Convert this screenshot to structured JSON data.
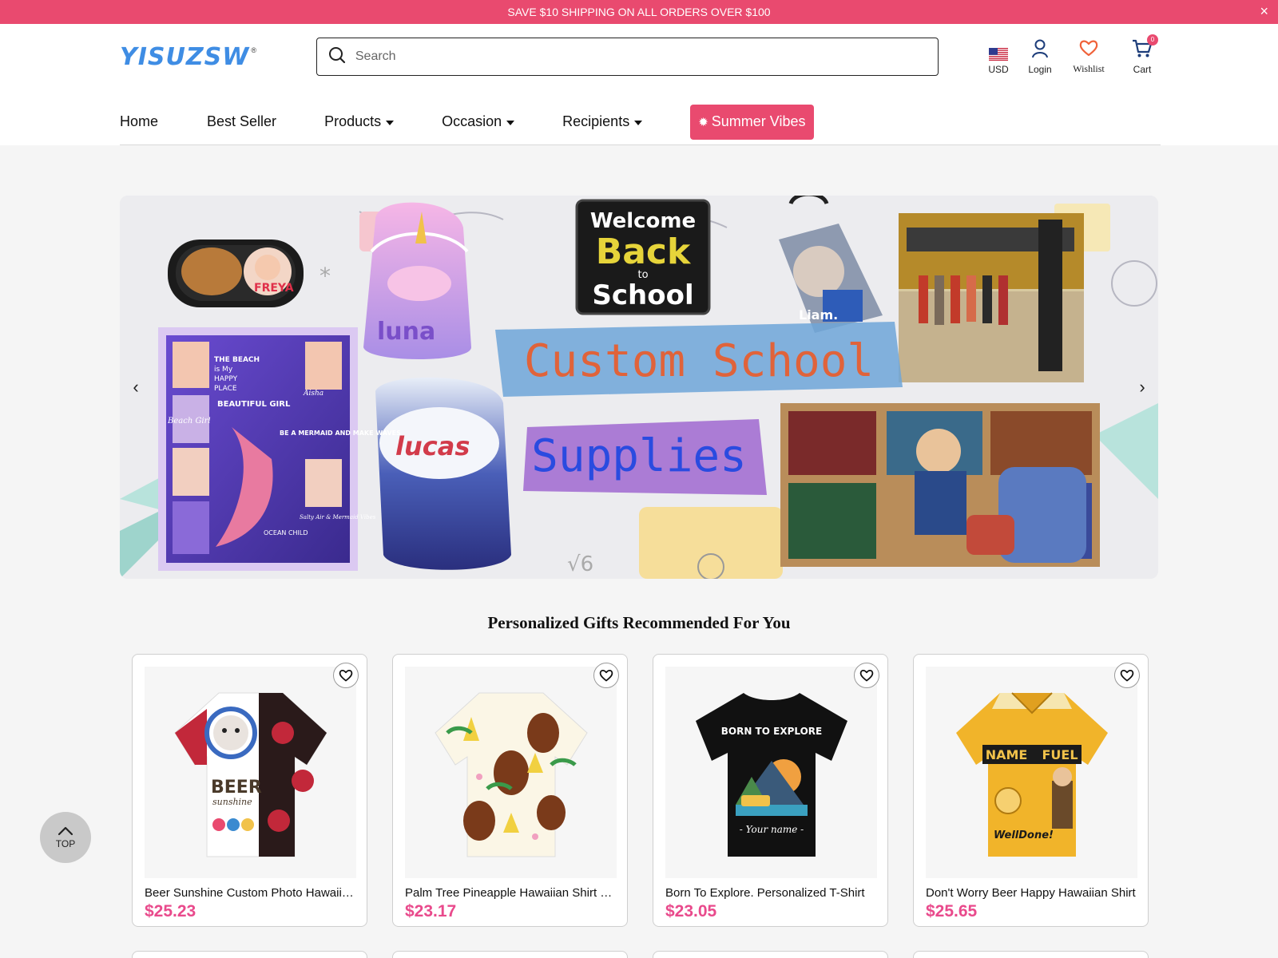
{
  "announcement": {
    "text": "SAVE $10 SHIPPING ON ALL ORDERS OVER $100",
    "close": "×"
  },
  "header": {
    "logo": "YISUZSW",
    "logo_mark": "®",
    "search_placeholder": "Search",
    "currency_label": "USD",
    "login_label": "Login",
    "wishlist_label": "Wishlist",
    "cart_label": "Cart",
    "cart_count": "0"
  },
  "nav": {
    "items": [
      {
        "label": "Home"
      },
      {
        "label": "Best Seller"
      },
      {
        "label": "Products"
      },
      {
        "label": "Occasion"
      },
      {
        "label": "Recipients"
      }
    ],
    "highlight": "Summer Vibes"
  },
  "banner": {
    "headline_1": "Custom School",
    "headline_2": "Supplies",
    "chalk_1": "Welcome",
    "chalk_2": "Back",
    "chalk_3": "to",
    "chalk_4": "School",
    "names": [
      "FREYA",
      "luna",
      "Liam.",
      "lucas"
    ],
    "blanket_text": [
      "THE BEACH",
      "is My",
      "HAPPY",
      "PLACE",
      "BEAUTIFUL GIRL",
      "Beach Girl",
      "BE A MERMAID AND MAKE WAVES",
      "Aisha",
      "Salty Air & Mermaid Vibes",
      "OCEAN CHILD"
    ],
    "arrow_prev": "‹",
    "arrow_next": "›"
  },
  "section": {
    "title": "Personalized Gifts Recommended For You"
  },
  "products": [
    {
      "title": "Beer Sunshine Custom Photo Hawaiian Shirt",
      "price": "$25.23",
      "print": [
        "BEER",
        "sunshine"
      ]
    },
    {
      "title": "Palm Tree Pineapple Hawaiian Shirt Custom Dog Face",
      "price": "$23.17"
    },
    {
      "title": "Born To Explore. Personalized T-Shirt",
      "price": "$23.05",
      "print": [
        "BORN TO EXPLORE",
        "- Your name -"
      ]
    },
    {
      "title": "Don't Worry Beer Happy Hawaiian Shirt",
      "price": "$25.65",
      "print": [
        "NAME",
        "FUEL",
        "WellDone!"
      ]
    }
  ],
  "back_to_top": "TOP",
  "colors": {
    "accent": "#e94a6f",
    "price": "#e94a8c",
    "logo": "#3f8de4"
  }
}
